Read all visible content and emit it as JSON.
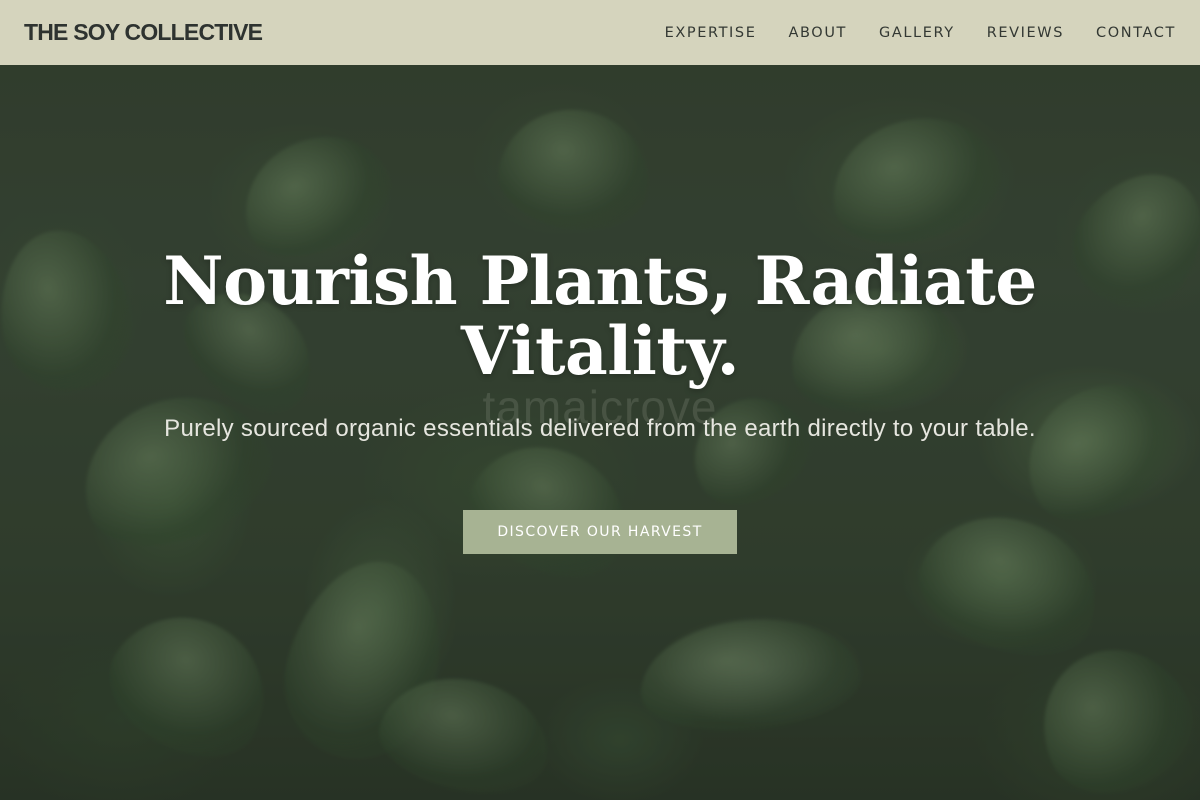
{
  "header": {
    "brand": "THE SOY COLLECTIVE",
    "nav": [
      {
        "label": "EXPERTISE"
      },
      {
        "label": "ABOUT"
      },
      {
        "label": "GALLERY"
      },
      {
        "label": "REVIEWS"
      },
      {
        "label": "CONTACT"
      }
    ]
  },
  "hero": {
    "title": "Nourish Plants, Radiate Vitality.",
    "ghost_text": "tamaicrove",
    "subtitle": "Purely sourced organic essentials delivered from the earth directly to your table.",
    "cta_label": "DISCOVER OUR HARVEST"
  },
  "colors": {
    "navbar_bg": "#e2e0c8",
    "brand_text": "#2e3330",
    "cta_bg": "#a7b393",
    "title_text": "#ffffff"
  }
}
